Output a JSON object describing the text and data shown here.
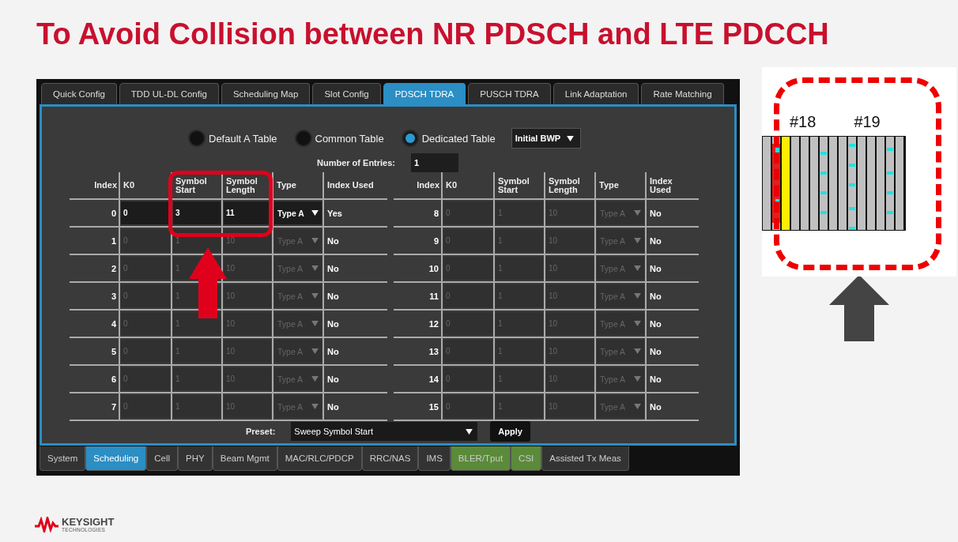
{
  "title": "To Avoid Collision between NR PDSCH and LTE PDCCH",
  "app": {
    "top_tabs": [
      {
        "label": "Quick Config",
        "selected": false
      },
      {
        "label": "TDD UL-DL Config",
        "selected": false
      },
      {
        "label": "Scheduling Map",
        "selected": false
      },
      {
        "label": "Slot Config",
        "selected": false
      },
      {
        "label": "PDSCH TDRA",
        "selected": true
      },
      {
        "label": "PUSCH TDRA",
        "selected": false
      },
      {
        "label": "Link Adaptation",
        "selected": false
      },
      {
        "label": "Rate Matching",
        "selected": false
      }
    ],
    "radios": [
      {
        "label": "Default A Table",
        "selected": false
      },
      {
        "label": "Common Table",
        "selected": false
      },
      {
        "label": "Dedicated Table",
        "selected": true
      }
    ],
    "bwp_select": {
      "value": "Initial BWP"
    },
    "entries": {
      "label": "Number of Entries:",
      "value": "1"
    },
    "tables": [
      {
        "columns": [
          "Index",
          "K0",
          "Symbol Start",
          "Symbol Length",
          "Type",
          "Index Used"
        ],
        "rows": [
          {
            "index": "0",
            "k0": "0",
            "start": "3",
            "length": "11",
            "type": "Type A",
            "used": "Yes",
            "enabled": true
          },
          {
            "index": "1",
            "k0": "0",
            "start": "1",
            "length": "10",
            "type": "Type A",
            "used": "No",
            "enabled": false
          },
          {
            "index": "2",
            "k0": "0",
            "start": "1",
            "length": "10",
            "type": "Type A",
            "used": "No",
            "enabled": false
          },
          {
            "index": "3",
            "k0": "0",
            "start": "1",
            "length": "10",
            "type": "Type A",
            "used": "No",
            "enabled": false
          },
          {
            "index": "4",
            "k0": "0",
            "start": "1",
            "length": "10",
            "type": "Type A",
            "used": "No",
            "enabled": false
          },
          {
            "index": "5",
            "k0": "0",
            "start": "1",
            "length": "10",
            "type": "Type A",
            "used": "No",
            "enabled": false
          },
          {
            "index": "6",
            "k0": "0",
            "start": "1",
            "length": "10",
            "type": "Type A",
            "used": "No",
            "enabled": false
          },
          {
            "index": "7",
            "k0": "0",
            "start": "1",
            "length": "10",
            "type": "Type A",
            "used": "No",
            "enabled": false
          }
        ]
      },
      {
        "columns": [
          "Index",
          "K0",
          "Symbol Start",
          "Symbol Length",
          "Type",
          "Index Used"
        ],
        "rows": [
          {
            "index": "8",
            "k0": "0",
            "start": "1",
            "length": "10",
            "type": "Type A",
            "used": "No",
            "enabled": false
          },
          {
            "index": "9",
            "k0": "0",
            "start": "1",
            "length": "10",
            "type": "Type A",
            "used": "No",
            "enabled": false
          },
          {
            "index": "10",
            "k0": "0",
            "start": "1",
            "length": "10",
            "type": "Type A",
            "used": "No",
            "enabled": false
          },
          {
            "index": "11",
            "k0": "0",
            "start": "1",
            "length": "10",
            "type": "Type A",
            "used": "No",
            "enabled": false
          },
          {
            "index": "12",
            "k0": "0",
            "start": "1",
            "length": "10",
            "type": "Type A",
            "used": "No",
            "enabled": false
          },
          {
            "index": "13",
            "k0": "0",
            "start": "1",
            "length": "10",
            "type": "Type A",
            "used": "No",
            "enabled": false
          },
          {
            "index": "14",
            "k0": "0",
            "start": "1",
            "length": "10",
            "type": "Type A",
            "used": "No",
            "enabled": false
          },
          {
            "index": "15",
            "k0": "0",
            "start": "1",
            "length": "10",
            "type": "Type A",
            "used": "No",
            "enabled": false
          }
        ]
      }
    ],
    "preset": {
      "label": "Preset:",
      "value": "Sweep Symbol Start"
    },
    "apply": "Apply",
    "bottom_tabs": [
      {
        "label": "System",
        "selected": false
      },
      {
        "label": "Scheduling",
        "selected": true
      },
      {
        "label": "Cell",
        "selected": false
      },
      {
        "label": "PHY",
        "selected": false
      },
      {
        "label": "Beam Mgmt",
        "selected": false
      },
      {
        "label": "MAC/RLC/PDCP",
        "selected": false
      },
      {
        "label": "RRC/NAS",
        "selected": false
      },
      {
        "label": "IMS",
        "selected": false
      },
      {
        "label": "BLER/Tput",
        "selected": false,
        "color": "#5b8a3a"
      },
      {
        "label": "CSI",
        "selected": false,
        "color": "#5b8a3a"
      },
      {
        "label": "Assisted Tx Meas",
        "selected": false
      }
    ]
  },
  "inset": {
    "slot_labels": [
      "#18",
      "#19"
    ]
  },
  "logo": {
    "name": "KEYSIGHT",
    "subtitle": "TECHNOLOGIES"
  }
}
